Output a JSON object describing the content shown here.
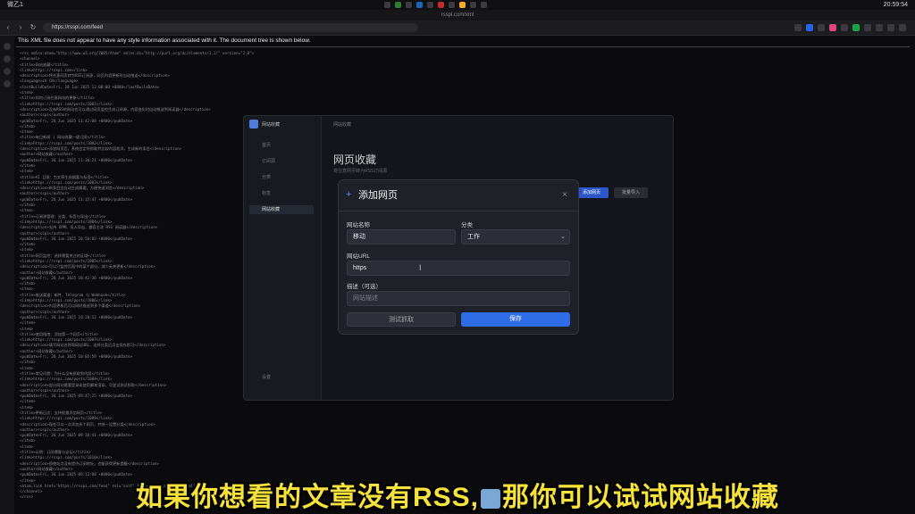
{
  "menubar": {
    "left": "微乙1",
    "right": "20:59:54"
  },
  "browser": {
    "tab_url": "rsspi.com/xml",
    "url": "https://rsspi.com/feed"
  },
  "xml_notice": "This XML file does not appear to have any style information associated with it. The document tree is shown below.",
  "xml_lines": [
    "<rss xmlns:atom=\"http://www.w3.org/2005/Atom\" xmlns:dc=\"http://purl.org/dc/elements/1.1/\" version=\"2.0\">",
    "  <channel>",
    "    <title>网站收藏</title>",
    "    <link>https://rsspi.com</link>",
    "    <description>将任意网页转为RSS订阅源，网页内容更新时自动推送</description>",
    "    <language>zh-CN</language>",
    "    <lastBuildDate>Fri, 20 Jun 2025 12:00:00 +0800</lastBuildDate>",
    "    <item>",
    "      <title>如何订阅任意网站的更新</title>",
    "      <link>https://rsspi.com/posts/1001</link>",
    "      <description>没有RSS的网站也可以通过网页监控生成订阅源，内容变化时自动推送到阅读器</description>",
    "      <author>rsspi</author>",
    "      <pubDate>Fri, 20 Jun 2025 11:42:08 +0800</pubDate>",
    "    </item>",
    "    <item>",
    "      <title>每日新闻 | 网站收藏一键订阅</title>",
    "      <link>https://rsspi.com/posts/1002</link>",
    "      <description>添加网页后，系统会定时抓取并比较内容差异，生成新的条目</description>",
    "      <author>网站收藏</author>",
    "      <pubDate>Fri, 20 Jun 2025 11:30:21 +0800</pubDate>",
    "    </item>",
    "    <item>",
    "      <title>AI 日报：为文章生成摘要与标签</title>",
    "      <link>https://rsspi.com/posts/1003</link>",
    "      <description>新条目会自动生成摘要，方便快速浏览</description>",
    "      <author>rsspi</author>",
    "      <pubDate>Fri, 20 Jun 2025 11:15:47 +0800</pubDate>",
    "    </item>",
    "    <item>",
    "      <title>订阅源管理：分类、标签与导出</title>",
    "      <link>https://rsspi.com/posts/1004</link>",
    "      <description>支持 OPML 导入导出，兼容主流 RSS 阅读器</description>",
    "      <author>rsspi</author>",
    "      <pubDate>Fri, 20 Jun 2025 10:58:03 +0800</pubDate>",
    "    </item>",
    "    <item>",
    "      <title>网页监控：选择需要关注的区域</title>",
    "      <link>https://rsspi.com/posts/1005</link>",
    "      <description>可以只监控页面中的某个部分，减少无关更新</description>",
    "      <author>网站收藏</author>",
    "      <pubDate>Fri, 20 Jun 2025 10:41:36 +0800</pubDate>",
    "    </item>",
    "    <item>",
    "      <title>推送渠道：邮件、Telegram 与 Webhook</title>",
    "      <link>https://rsspi.com/posts/1006</link>",
    "      <description>内容更新后可以同时推送到多个渠道</description>",
    "      <author>rsspi</author>",
    "      <pubDate>Fri, 20 Jun 2025 10:20:12 +0800</pubDate>",
    "    </item>",
    "    <item>",
    "      <title>使用指南：添加第一个网页</title>",
    "      <link>https://rsspi.com/posts/1007</link>",
    "      <description>填写网站名称和网站URL，选择分类后点击保存即可</description>",
    "      <author>网站收藏</author>",
    "      <pubDate>Fri, 20 Jun 2025 10:05:59 +0800</pubDate>",
    "    </item>",
    "    <item>",
    "      <title>常见问题：为什么没有抓取到内容</title>",
    "      <link>https://rsspi.com/posts/1008</link>",
    "      <description>部分网站需要登录或使用脚本渲染，可尝试测试抓取</description>",
    "      <author>rsspi</author>",
    "      <pubDate>Fri, 20 Jun 2025 09:47:25 +0800</pubDate>",
    "    </item>",
    "    <item>",
    "      <title>更新日志：支持批量添加网页</title>",
    "      <link>https://rsspi.com/posts/1009</link>",
    "      <description>现在可以一次添加多个网页，并统一设置分类</description>",
    "      <author>rsspi</author>",
    "      <pubDate>Fri, 20 Jun 2025 09:30:41 +0800</pubDate>",
    "    </item>",
    "    <item>",
    "      <title>示例：订阅博客与论坛</title>",
    "      <link>https://rsspi.com/posts/1010</link>",
    "      <description>即使站点没有提供订阅地址，也能获得更新提醒</description>",
    "      <author>网站收藏</author>",
    "      <pubDate>Fri, 20 Jun 2025 09:12:08 +0800</pubDate>",
    "    </item>",
    "    <atom:link href=\"https://rsspi.com/feed\" rel=\"self\" type=\"application/rss+xml\"/>",
    "  </channel>",
    "</rss>"
  ],
  "app": {
    "window_title": "网站收藏",
    "logo_text": "网站收藏",
    "nav": [
      "首页",
      "订阅源",
      "分类",
      "标签",
      "网站收藏",
      "设置"
    ],
    "page_heading": "网页收藏",
    "page_desc": "将任意网页转为RSS订阅源",
    "primary_btn": "添加网页",
    "secondary_btn": "批量导入"
  },
  "modal": {
    "title": "添加网页",
    "name_label": "网站名称",
    "name_value": "移动",
    "category_label": "分类",
    "category_value": "工作",
    "url_label": "网站URL",
    "url_value": "https",
    "desc_label": "描述（可选）",
    "desc_placeholder": "网站描述",
    "test_button": "测试抓取",
    "save_button": "保存"
  },
  "subtitle": {
    "part1": "如果你想看的文章没有RSS,",
    "part2": "那你可以试试网站收藏"
  }
}
